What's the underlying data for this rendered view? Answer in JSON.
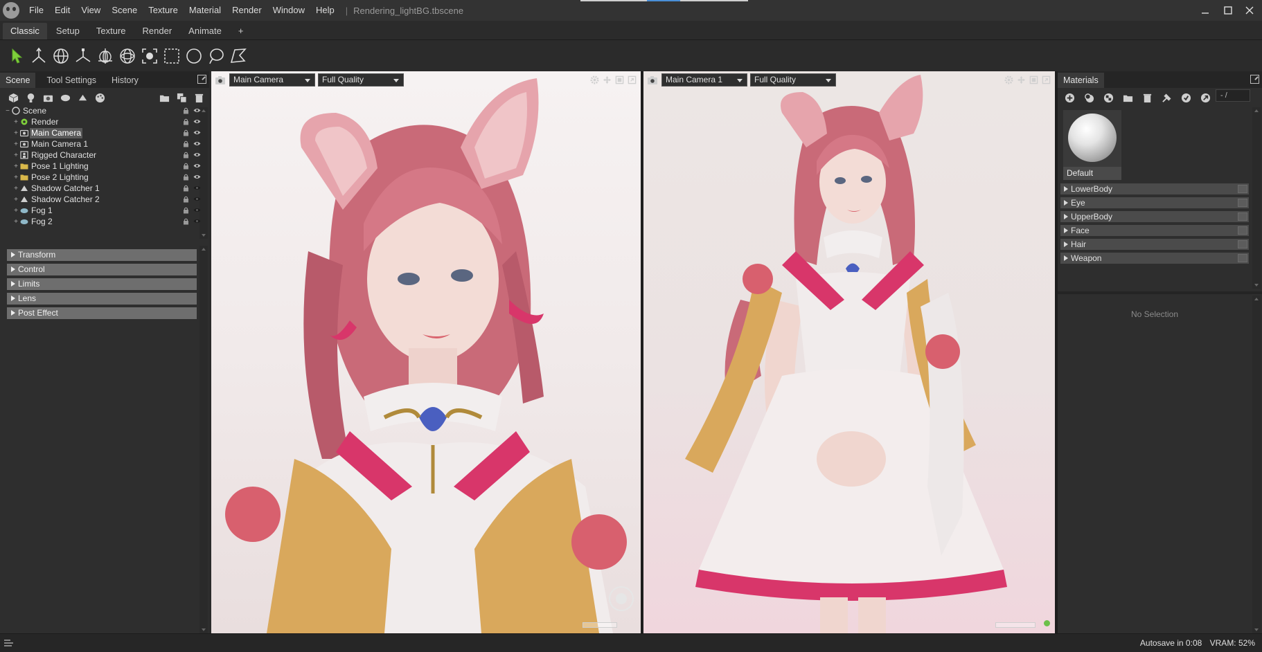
{
  "window": {
    "menu": [
      "File",
      "Edit",
      "View",
      "Scene",
      "Texture",
      "Material",
      "Render",
      "Window",
      "Help"
    ],
    "separator": "|",
    "document_title": "Rendering_lightBG.tbscene"
  },
  "workspace_tabs": [
    "Classic",
    "Setup",
    "Texture",
    "Render",
    "Animate",
    "+"
  ],
  "toolbar": {
    "tools": [
      "select-tool-icon",
      "move-tool-icon",
      "rotate-tool-icon",
      "scale-tool-icon",
      "rotate-widget-icon",
      "transform-widget-icon",
      "focus-tool-icon",
      "rect-select-icon",
      "circle-select-icon",
      "lasso-select-icon",
      "poly-select-icon"
    ],
    "accent_color": "#7fd13b"
  },
  "left_panel": {
    "tabs": [
      "Scene",
      "Tool Settings",
      "History"
    ],
    "tree": [
      {
        "label": "Scene",
        "icon": "scene-icon",
        "level": 0
      },
      {
        "label": "Render",
        "icon": "render-gear-icon",
        "level": 1
      },
      {
        "label": "Main Camera",
        "icon": "camera-icon",
        "level": 1,
        "selected": true
      },
      {
        "label": "Main Camera 1",
        "icon": "camera-icon",
        "level": 1
      },
      {
        "label": "Rigged Character",
        "icon": "character-icon",
        "level": 1
      },
      {
        "label": "Pose 1 Lighting",
        "icon": "folder-icon",
        "level": 1
      },
      {
        "label": "Pose 2 Lighting",
        "icon": "folder-icon",
        "level": 1
      },
      {
        "label": "Shadow Catcher 1",
        "icon": "shadow-catcher-icon",
        "level": 1
      },
      {
        "label": "Shadow Catcher 2",
        "icon": "shadow-catcher-icon",
        "level": 1
      },
      {
        "label": "Fog 1",
        "icon": "fog-icon",
        "level": 1
      },
      {
        "label": "Fog 2",
        "icon": "fog-icon",
        "level": 1
      }
    ],
    "properties": [
      "Transform",
      "Control",
      "Limits",
      "Lens",
      "Post Effect"
    ]
  },
  "viewport_left": {
    "camera": "Main Camera",
    "quality": "Full Quality"
  },
  "viewport_right": {
    "camera": "Main Camera 1",
    "quality": "Full Quality"
  },
  "materials_panel": {
    "title": "Materials",
    "search_value": "- /",
    "selected_material": "Default",
    "groups": [
      "LowerBody",
      "Eye",
      "UpperBody",
      "Face",
      "Hair",
      "Weapon"
    ],
    "no_selection_text": "No Selection"
  },
  "status": {
    "autosave": "Autosave in 0:08",
    "vram": "VRAM: 52%"
  }
}
